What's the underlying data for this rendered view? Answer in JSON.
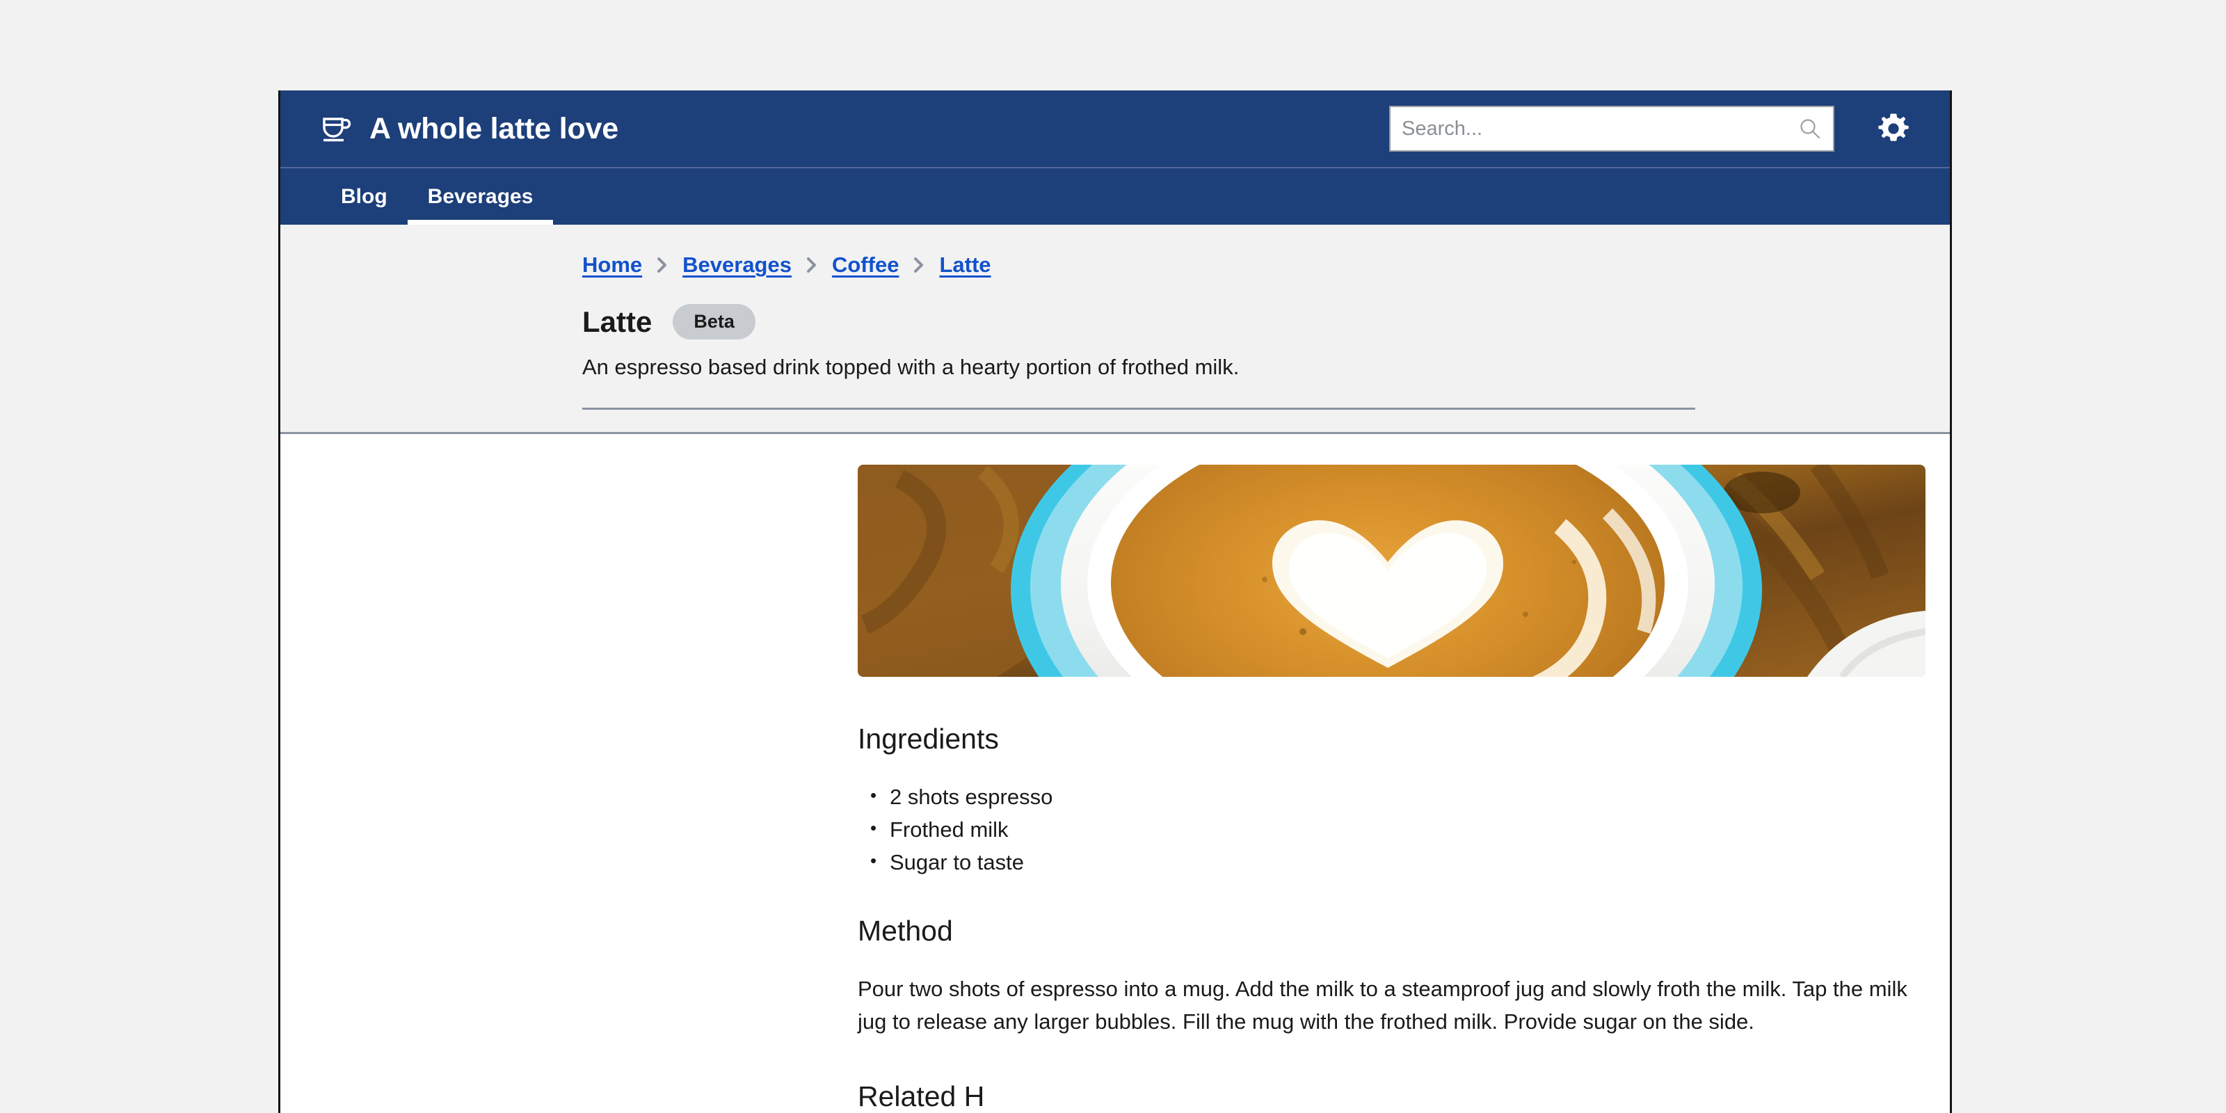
{
  "header": {
    "brand_title": "A whole latte love",
    "logo_icon": "coffee-cup-icon",
    "search": {
      "placeholder": "Search...",
      "value": "",
      "icon": "search-icon"
    },
    "settings_icon": "gear-icon"
  },
  "nav": {
    "tabs": [
      {
        "label": "Blog",
        "active": false
      },
      {
        "label": "Beverages",
        "active": true
      }
    ]
  },
  "breadcrumb": {
    "separator_icon": "chevron-right-icon",
    "items": [
      {
        "label": "Home"
      },
      {
        "label": "Beverages"
      },
      {
        "label": "Coffee"
      },
      {
        "label": "Latte"
      }
    ]
  },
  "hero": {
    "title": "Latte",
    "badge": "Beta",
    "description": "An espresso based drink topped with a hearty portion of frothed milk."
  },
  "main": {
    "photo_alt": "latte-art-photo",
    "ingredients": {
      "heading": "Ingredients",
      "items": [
        "2 shots espresso",
        "Frothed milk",
        "Sugar to taste"
      ]
    },
    "method": {
      "heading": "Method",
      "body": "Pour two shots of espresso into a mug. Add the milk to a steamproof jug and slowly froth the milk. Tap the milk jug to release any larger bubbles. Fill the mug with the frothed milk. Provide sugar on the side."
    },
    "next_section_heading": "Related H"
  },
  "colors": {
    "header_blue": "#1d3f7a",
    "link_blue": "#1152cc",
    "badge_gray": "#c8ccd0",
    "hero_gray": "#f2f2f3",
    "rule_gray": "#8b93a0"
  }
}
